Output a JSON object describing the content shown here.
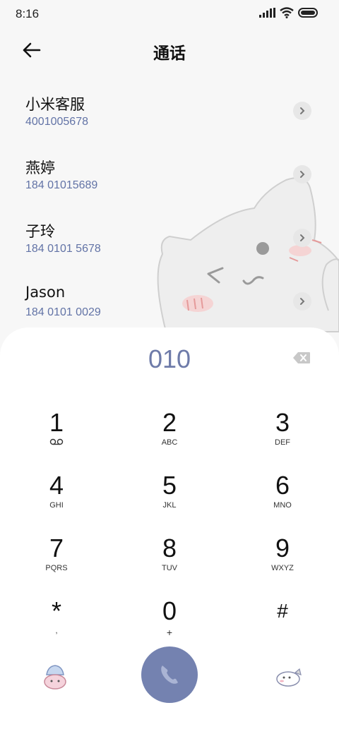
{
  "status": {
    "time": "8:16"
  },
  "header": {
    "title": "通话"
  },
  "contacts": [
    {
      "name": "小米客服",
      "number": "4001005678"
    },
    {
      "name": "燕婷",
      "number": "184 01015689"
    },
    {
      "name": "子玲",
      "number": "184 0101 5678"
    },
    {
      "name": "Jason",
      "number": "184 0101 0029"
    }
  ],
  "dialer": {
    "entered": "010",
    "keys": [
      {
        "digit": "1",
        "letters": ""
      },
      {
        "digit": "2",
        "letters": "ABC"
      },
      {
        "digit": "3",
        "letters": "DEF"
      },
      {
        "digit": "4",
        "letters": "GHI"
      },
      {
        "digit": "5",
        "letters": "JKL"
      },
      {
        "digit": "6",
        "letters": "MNO"
      },
      {
        "digit": "7",
        "letters": "PQRS"
      },
      {
        "digit": "8",
        "letters": "TUV"
      },
      {
        "digit": "9",
        "letters": "WXYZ"
      },
      {
        "digit": "*",
        "letters": ","
      },
      {
        "digit": "0",
        "letters": "+"
      },
      {
        "digit": "#",
        "letters": ""
      }
    ]
  },
  "colors": {
    "accent": "#7482b0",
    "number_text": "#6273a6",
    "panel": "#ffffff"
  }
}
